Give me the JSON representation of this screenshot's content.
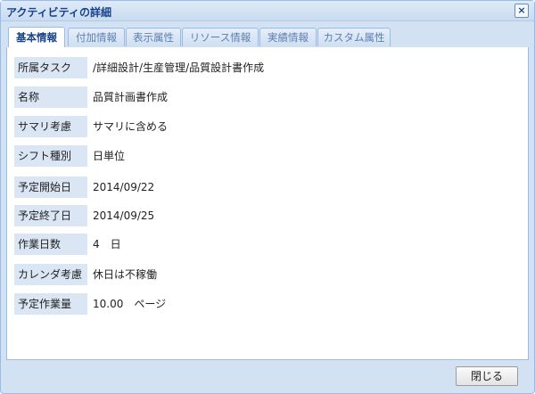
{
  "window": {
    "title": "アクティビティの詳細",
    "close_symbol": "×"
  },
  "tabs": [
    {
      "label": "基本情報",
      "active": true
    },
    {
      "label": "付加情報",
      "active": false
    },
    {
      "label": "表示属性",
      "active": false
    },
    {
      "label": "リソース情報",
      "active": false
    },
    {
      "label": "実績情報",
      "active": false
    },
    {
      "label": "カスタム属性",
      "active": false
    }
  ],
  "fields": [
    {
      "label": "所属タスク",
      "value": "/詳細設計/生産管理/品質設計書作成"
    },
    {
      "label": "名称",
      "value": "品質計画書作成"
    },
    {
      "label": "サマリ考慮",
      "value": "サマリに含める"
    },
    {
      "label": "シフト種別",
      "value": "日単位"
    },
    {
      "label": "予定開始日",
      "value": "2014/09/22"
    },
    {
      "label": "予定終了日",
      "value": "2014/09/25"
    },
    {
      "label": "作業日数",
      "value": "4　日"
    },
    {
      "label": "カレンダ考慮",
      "value": "休日は不稼働"
    },
    {
      "label": "予定作業量",
      "value": "10.00　ページ"
    }
  ],
  "footer": {
    "close_label": "閉じる"
  },
  "colors": {
    "accent": "#15428b",
    "border": "#99bbe8",
    "label_bg": "#dbe6f4"
  }
}
